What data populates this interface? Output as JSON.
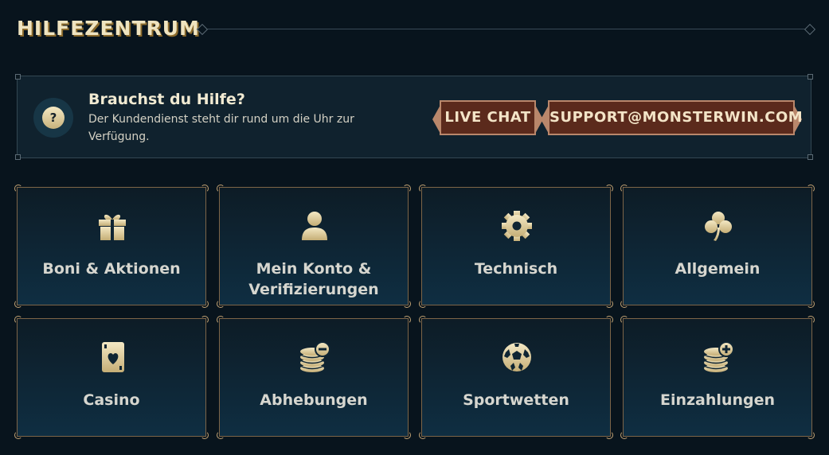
{
  "header": {
    "title": "HILFEZENTRUM"
  },
  "help": {
    "title": "Brauchst du Hilfe?",
    "description": "Der Kundendienst steht dir rund um die Uhr zur Verfügung.",
    "icon": "question-icon",
    "live_chat_label": "LIVE CHAT",
    "email_label": "SUPPORT@MONSTERWIN.COM"
  },
  "categories": [
    {
      "label": "Boni & Aktionen",
      "icon": "gift-icon"
    },
    {
      "label": "Mein Konto & Verifizierungen",
      "icon": "user-icon"
    },
    {
      "label": "Technisch",
      "icon": "gear-icon"
    },
    {
      "label": "Allgemein",
      "icon": "clover-icon"
    },
    {
      "label": "Casino",
      "icon": "playing-card-icon"
    },
    {
      "label": "Abhebungen",
      "icon": "coins-minus-icon"
    },
    {
      "label": "Sportwetten",
      "icon": "soccer-ball-icon"
    },
    {
      "label": "Einzahlungen",
      "icon": "coins-plus-icon"
    }
  ],
  "colors": {
    "background": "#08141d",
    "accent_gold": "#e9dcae",
    "button_red": "#5b2a1c",
    "card_border": "#7d6548"
  }
}
